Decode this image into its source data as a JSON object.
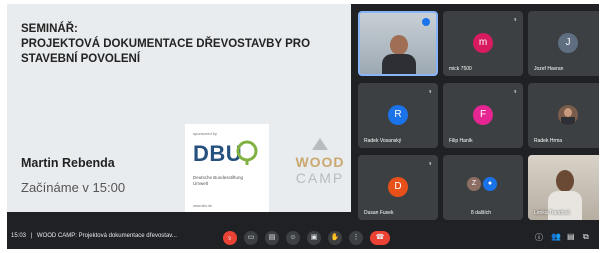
{
  "slide": {
    "title": "SEMINÁŘ:\nPROJEKTOVÁ DOKUMENTACE DŘEVOSTAVBY PRO STAVEBNÍ POVOLENÍ",
    "speaker": "Martin Rebenda",
    "start": "Začínáme v 15:00",
    "sponsor_label": "sponsored by",
    "sponsor_logo": "DBU",
    "sponsor_sub": "Deutsche Bundesstiftung Umwelt",
    "sponsor_url": "www.dbu.de",
    "camp_logo_top": "WOOD",
    "camp_logo_bottom": "CAMP"
  },
  "participants": [
    {
      "name": "",
      "type": "video",
      "initial": "",
      "color": ""
    },
    {
      "name": "mick 7500",
      "type": "avatar",
      "initial": "m",
      "color": "#d81b60"
    },
    {
      "name": "Jozef Havran",
      "type": "avatar",
      "initial": "J",
      "color": "#5f6f81"
    },
    {
      "name": "Radek Vosanský",
      "type": "avatar",
      "initial": "R",
      "color": "#1a73e8"
    },
    {
      "name": "Filip Haník",
      "type": "avatar",
      "initial": "F",
      "color": "#e52592"
    },
    {
      "name": "Radek Hrma",
      "type": "video",
      "initial": "",
      "color": ""
    },
    {
      "name": "Dusan Fusek",
      "type": "avatar",
      "initial": "D",
      "color": "#e8501a"
    },
    {
      "name": "8 dalších",
      "type": "group",
      "initial": "Z",
      "color": "#8d6e63"
    },
    {
      "name": "Lenka Trandová",
      "type": "video",
      "initial": "",
      "color": ""
    }
  ],
  "bottom": {
    "time": "15:03",
    "separator": "|",
    "meeting_title": "WOOD CAMP: Projektová dokumentace dřevostav..."
  },
  "icons": {
    "mic": "microphone-off-icon",
    "camera": "camera-icon",
    "captions": "captions-icon",
    "emoji": "emoji-icon",
    "present": "present-screen-icon",
    "hand": "raise-hand-icon",
    "more": "more-options-icon",
    "end": "end-call-icon",
    "info": "info-icon",
    "people": "people-icon",
    "chat": "chat-icon",
    "activities": "activities-icon"
  },
  "colors": {
    "accent_red": "#ea4335",
    "accent_blue": "#8ab4f8",
    "bar": "#202124"
  }
}
